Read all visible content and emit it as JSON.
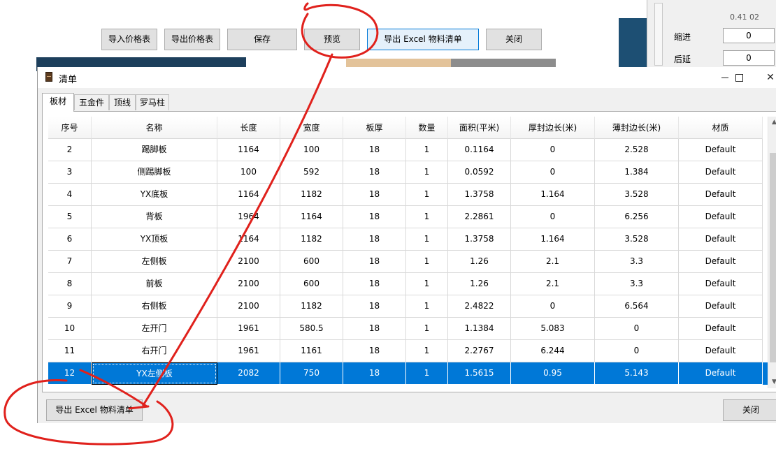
{
  "background_app": {
    "toolbar_buttons": [
      {
        "label": "导入价格表"
      },
      {
        "label": "导出价格表"
      },
      {
        "label": "保存"
      },
      {
        "label": "预览"
      },
      {
        "label": "导出 Excel 物料清单"
      },
      {
        "label": "关闭"
      }
    ],
    "side_panel": {
      "top_value": "0.41 02",
      "fields": [
        {
          "label": "缩进",
          "value": "0"
        },
        {
          "label": "后延",
          "value": "0"
        }
      ]
    }
  },
  "dialog": {
    "title": "清单",
    "controls": {
      "minimize": "—",
      "maximize": "☐",
      "close": "✕"
    },
    "tabs": [
      {
        "label": "板材",
        "active": true
      },
      {
        "label": "五金件",
        "active": false
      },
      {
        "label": "顶线",
        "active": false
      },
      {
        "label": "罗马柱",
        "active": false
      }
    ],
    "table": {
      "headers": [
        "序号",
        "名称",
        "长度",
        "宽度",
        "板厚",
        "数量",
        "面积(平米)",
        "厚封边长(米)",
        "薄封边长(米)",
        "材质"
      ],
      "rows": [
        [
          "2",
          "踢脚板",
          "1164",
          "100",
          "18",
          "1",
          "0.1164",
          "0",
          "2.528",
          "Default"
        ],
        [
          "3",
          "侧踢脚板",
          "100",
          "592",
          "18",
          "1",
          "0.0592",
          "0",
          "1.384",
          "Default"
        ],
        [
          "4",
          "YX底板",
          "1164",
          "1182",
          "18",
          "1",
          "1.3758",
          "1.164",
          "3.528",
          "Default"
        ],
        [
          "5",
          "背板",
          "1964",
          "1164",
          "18",
          "1",
          "2.2861",
          "0",
          "6.256",
          "Default"
        ],
        [
          "6",
          "YX顶板",
          "1164",
          "1182",
          "18",
          "1",
          "1.3758",
          "1.164",
          "3.528",
          "Default"
        ],
        [
          "7",
          "左侧板",
          "2100",
          "600",
          "18",
          "1",
          "1.26",
          "2.1",
          "3.3",
          "Default"
        ],
        [
          "8",
          "前板",
          "2100",
          "600",
          "18",
          "1",
          "1.26",
          "2.1",
          "3.3",
          "Default"
        ],
        [
          "9",
          "右侧板",
          "2100",
          "1182",
          "18",
          "1",
          "2.4822",
          "0",
          "6.564",
          "Default"
        ],
        [
          "10",
          "左开门",
          "1961",
          "580.5",
          "18",
          "1",
          "1.1384",
          "5.083",
          "0",
          "Default"
        ],
        [
          "11",
          "右开门",
          "1961",
          "1161",
          "18",
          "1",
          "2.2767",
          "6.244",
          "0",
          "Default"
        ],
        [
          "12",
          "YX左侧板",
          "2082",
          "750",
          "18",
          "1",
          "1.5615",
          "0.95",
          "5.143",
          "Default"
        ]
      ],
      "selected_row": "12",
      "scrollbar": {
        "up": "▲",
        "down": "▼"
      }
    },
    "export_button": "导出 Excel 物料清单",
    "close_button": "关闭"
  },
  "colors": {
    "selection": "#0078d7",
    "annotation": "#e0211c"
  },
  "icons": [
    "list-window-icon",
    "minimize-icon",
    "maximize-icon",
    "close-icon",
    "scroll-up-icon",
    "scroll-down-icon"
  ]
}
